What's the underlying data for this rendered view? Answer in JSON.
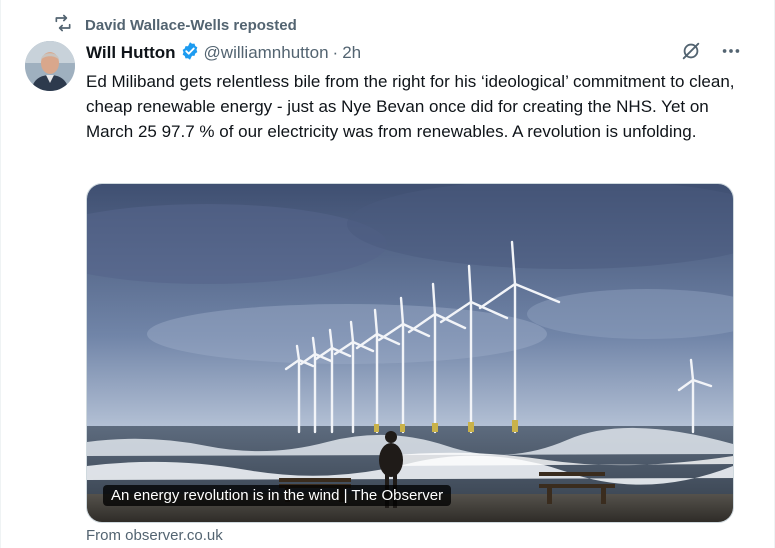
{
  "repost": {
    "icon": "repost-icon",
    "text": "David Wallace-Wells reposted"
  },
  "author": {
    "name": "Will Hutton",
    "verified_icon": "verified-badge-icon",
    "handle": "@williamnhutton",
    "separator": "·",
    "time": "2h"
  },
  "actions": {
    "grok_icon": "grok-icon",
    "more_icon": "more-options-icon"
  },
  "tweet": {
    "text": "Ed Miliband gets relentless bile from the right for his ‘ideological’ commitment to clean, cheap renewable energy - just as Nye Bevan once did for creating the NHS. Yet on March 25 97.7 % of our electricity was from renewables. A revolution is unfolding."
  },
  "card": {
    "caption": "An energy revolution is in the wind | The Observer",
    "source": "From observer.co.uk"
  },
  "colors": {
    "text": "#0f1419",
    "muted": "#536471",
    "verified": "#1d9bf0"
  }
}
